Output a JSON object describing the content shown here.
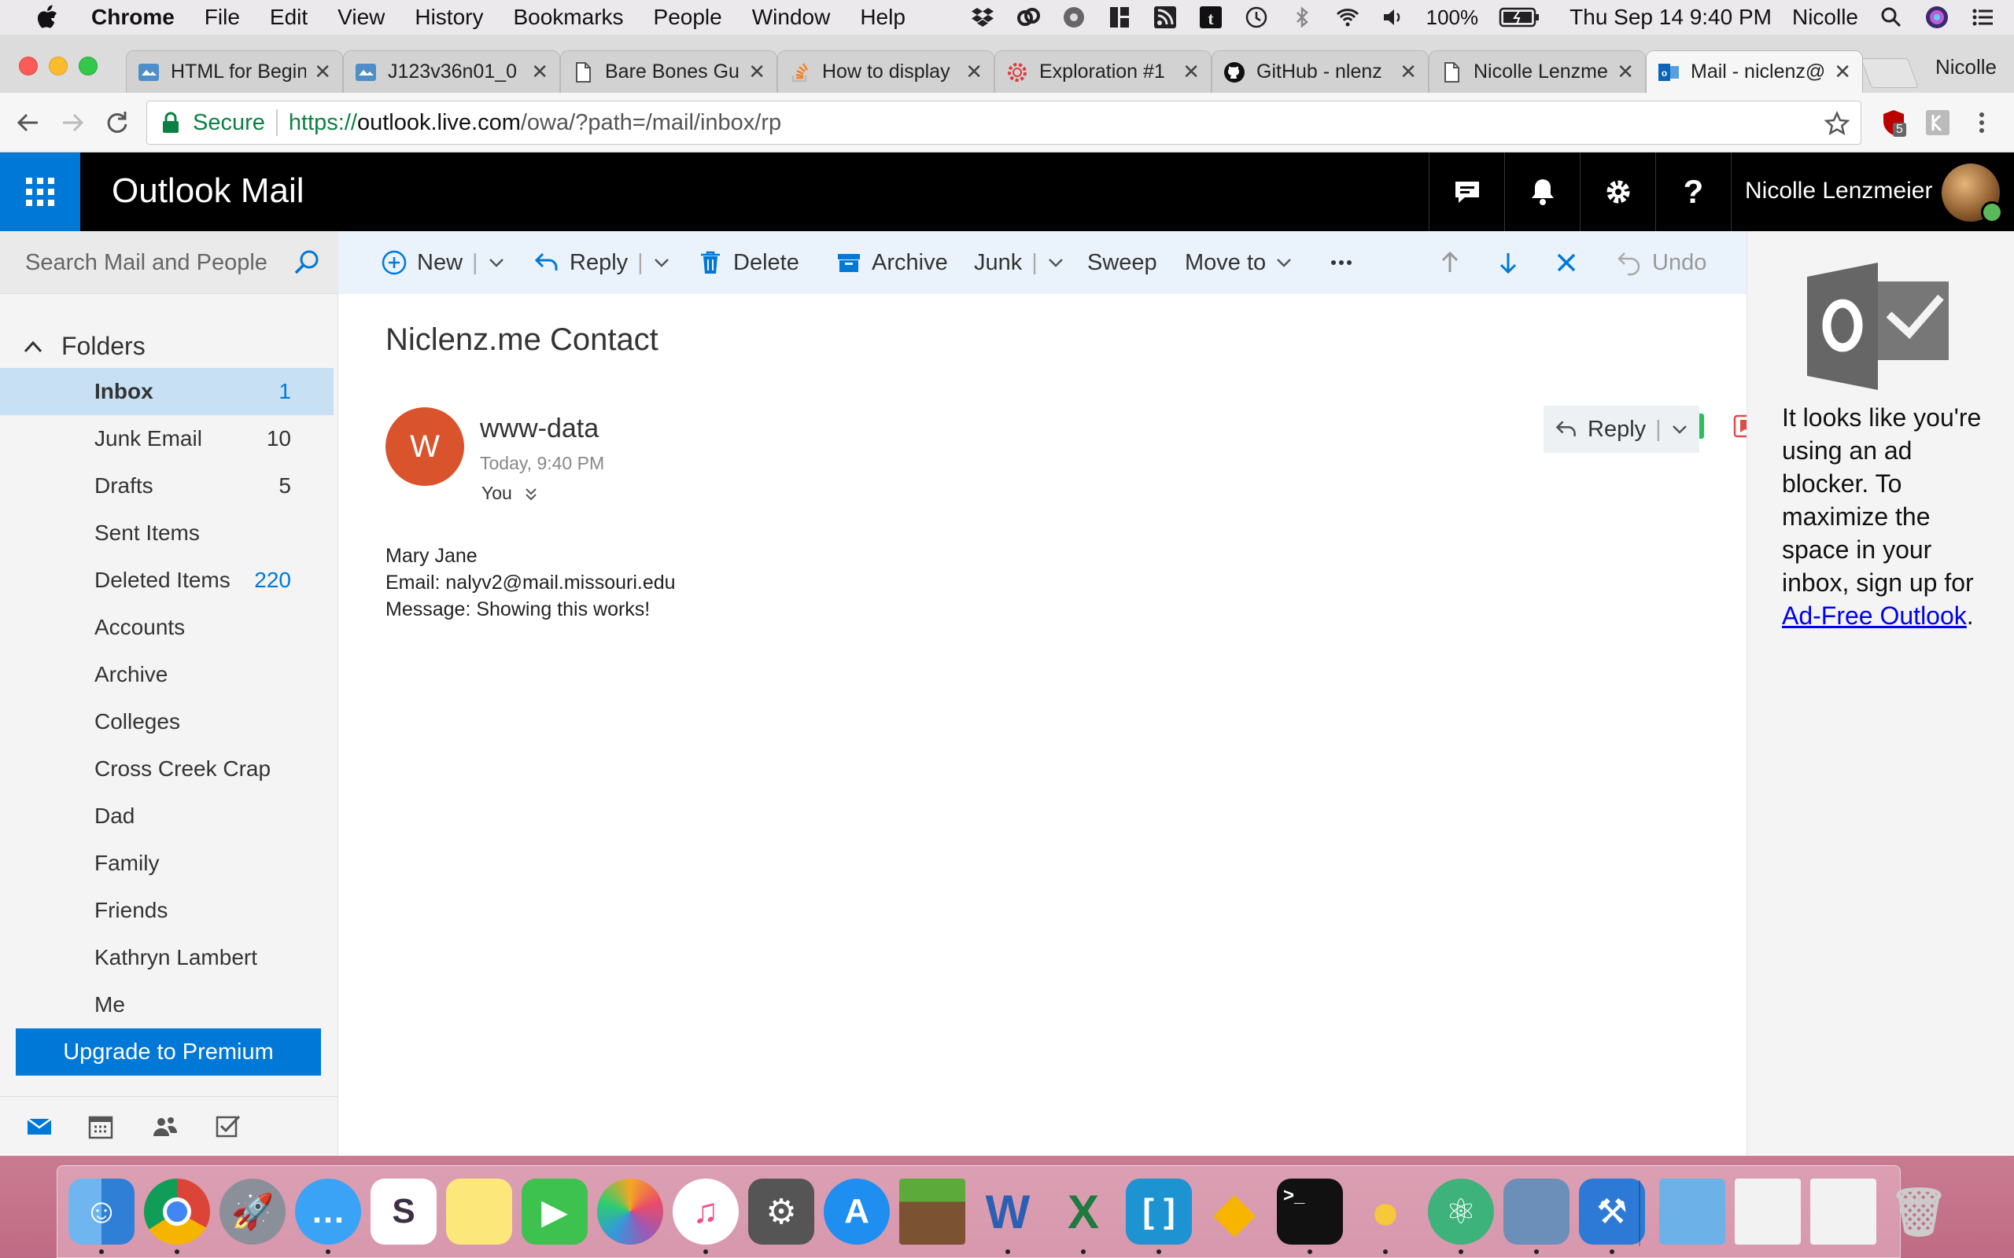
{
  "menubar": {
    "app_name": "Chrome",
    "items": [
      "File",
      "Edit",
      "View",
      "History",
      "Bookmarks",
      "People",
      "Window",
      "Help"
    ],
    "battery": "100%",
    "clock": "Thu Sep 14  9:40 PM",
    "user": "Nicolle"
  },
  "tabs": [
    {
      "title": "HTML for Beginners",
      "icon": "page-icon"
    },
    {
      "title": "J123v36n01_0",
      "icon": "page-icon"
    },
    {
      "title": "Bare Bones Guide",
      "icon": "document-icon"
    },
    {
      "title": "How to display",
      "icon": "stackoverflow-icon"
    },
    {
      "title": "Exploration #1",
      "icon": "gear-icon"
    },
    {
      "title": "GitHub - nlenz",
      "icon": "github-icon"
    },
    {
      "title": "Nicolle Lenzmeier",
      "icon": "document-icon"
    },
    {
      "title": "Mail - niclenz@",
      "icon": "outlook-icon"
    }
  ],
  "profile_name": "Nicolle",
  "omnibox": {
    "secure_label": "Secure",
    "scheme": "https://",
    "host": "outlook.live.com",
    "path": "/owa/?path=/mail/inbox/rp"
  },
  "extension_badge": "5",
  "owa": {
    "app_title": "Outlook Mail",
    "user_name": "Nicolle Lenzmeier",
    "search_placeholder": "Search Mail and People",
    "folders_label": "Folders",
    "folders": [
      {
        "name": "Inbox",
        "count": "1",
        "selected": true
      },
      {
        "name": "Junk Email",
        "count": "10"
      },
      {
        "name": "Drafts",
        "count": "5"
      },
      {
        "name": "Sent Items",
        "count": ""
      },
      {
        "name": "Deleted Items",
        "count": "220",
        "blue": true
      },
      {
        "name": "Accounts",
        "count": ""
      },
      {
        "name": "Archive",
        "count": ""
      },
      {
        "name": "Colleges",
        "count": ""
      },
      {
        "name": "Cross Creek Crap",
        "count": ""
      },
      {
        "name": "Dad",
        "count": ""
      },
      {
        "name": "Family",
        "count": ""
      },
      {
        "name": "Friends",
        "count": ""
      },
      {
        "name": "Kathryn Lambert",
        "count": ""
      },
      {
        "name": "Me",
        "count": ""
      }
    ],
    "upgrade_label": "Upgrade to Premium",
    "commands": {
      "new": "New",
      "reply": "Reply",
      "delete": "Delete",
      "archive": "Archive",
      "junk": "Junk",
      "sweep": "Sweep",
      "move_to": "Move to",
      "undo": "Undo"
    },
    "message": {
      "subject": "Niclenz.me Contact",
      "sender_initial": "W",
      "sender": "www-data",
      "time": "Today, 9:40 PM",
      "to": "You",
      "reply_label": "Reply",
      "body_lines": [
        "Mary Jane",
        "Email: nalyv2@mail.missouri.edu",
        "Message: Showing this works!"
      ]
    },
    "ad": {
      "text": "It looks like you're using an ad blocker. To maximize the space in your inbox, sign up for",
      "link": "Ad-Free Outlook",
      "after": "."
    }
  },
  "colors": {
    "accent": "#0078d7",
    "header_bg": "#000000",
    "avatar_bg": "#d9532c"
  }
}
